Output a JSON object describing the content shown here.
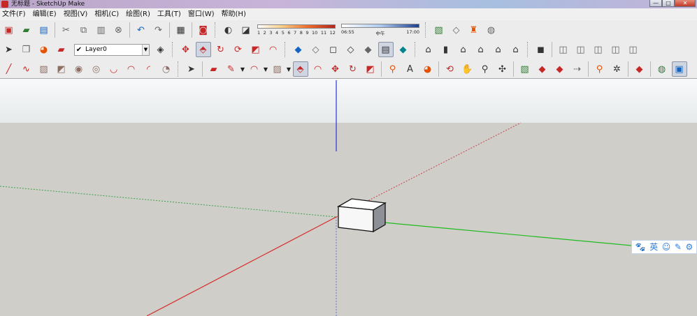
{
  "window": {
    "title": "无标题 - SketchUp Make",
    "controls": [
      "—",
      "□",
      "✕"
    ]
  },
  "menu": [
    "文件(F)",
    "编辑(E)",
    "视图(V)",
    "相机(C)",
    "绘图(R)",
    "工具(T)",
    "窗口(W)",
    "帮助(H)"
  ],
  "layer": {
    "check": "✔",
    "name": "Layer0",
    "arrow": "▼"
  },
  "shadow": {
    "months": [
      "1",
      "2",
      "3",
      "4",
      "5",
      "6",
      "7",
      "8",
      "9",
      "10",
      "11",
      "12"
    ],
    "time_start": "06:55",
    "time_mid": "中午",
    "time_end": "17:00"
  },
  "ime": {
    "paw": "🐾",
    "lang": "英",
    "smile": "☺",
    "pen": "✎",
    "gear": "⚙"
  },
  "dropdown_glyph": "▼",
  "icons": {
    "row1": [
      {
        "name": "new-model-icon",
        "g": "▣",
        "c": "c-red"
      },
      {
        "name": "open-folder-icon",
        "g": "▰",
        "c": "c-green"
      },
      {
        "name": "save-icon",
        "g": "▤",
        "c": "c-blue"
      },
      {
        "sep": true
      },
      {
        "name": "cut-icon",
        "g": "✂",
        "c": "c-gray"
      },
      {
        "name": "copy-icon",
        "g": "⧉",
        "c": "c-gray"
      },
      {
        "name": "paste-icon",
        "g": "▥",
        "c": "c-gray"
      },
      {
        "name": "erase-icon",
        "g": "⊗",
        "c": "c-gray"
      },
      {
        "sep": true
      },
      {
        "name": "undo-icon",
        "g": "↶",
        "c": "c-blue"
      },
      {
        "name": "redo-icon",
        "g": "↷",
        "c": "c-gray"
      },
      {
        "sep": true
      },
      {
        "name": "print-icon",
        "g": "▦",
        "c": "c-dark"
      },
      {
        "sep": true
      },
      {
        "name": "model-info-icon",
        "g": "◙",
        "c": "c-red"
      },
      {
        "grip": true
      },
      {
        "name": "shadow-settings-icon",
        "g": "◐",
        "c": "c-dark"
      },
      {
        "name": "display-shadows-icon",
        "g": "◪",
        "c": "c-dark"
      },
      {
        "slider": "warm"
      },
      {
        "slider": "cool"
      },
      {
        "grip": true
      },
      {
        "name": "add-location-icon",
        "g": "▧",
        "c": "c-green"
      },
      {
        "name": "toggle-terrain-icon",
        "g": "◇",
        "c": "c-gray"
      },
      {
        "name": "photo-textures-icon",
        "g": "♜",
        "c": "c-orange"
      },
      {
        "name": "preview-google-earth-icon",
        "g": "◍",
        "c": "c-gray"
      }
    ],
    "row2": [
      {
        "name": "select-icon",
        "g": "➤",
        "c": "c-dark"
      },
      {
        "name": "make-component-icon",
        "g": "❒",
        "c": "c-gray"
      },
      {
        "name": "paint-bucket-icon",
        "g": "◕",
        "c": "c-orange"
      },
      {
        "name": "eraser-icon",
        "g": "▰",
        "c": "c-red"
      },
      {
        "layer": true
      },
      {
        "name": "layer-manager-icon",
        "g": "◈",
        "c": "c-dark"
      },
      {
        "grip": true
      },
      {
        "name": "move-icon",
        "g": "✥",
        "c": "c-red"
      },
      {
        "name": "push-pull-icon",
        "g": "⬘",
        "c": "c-red",
        "pressed": true
      },
      {
        "name": "rotate-icon",
        "g": "↻",
        "c": "c-red"
      },
      {
        "name": "follow-me-icon",
        "g": "⟳",
        "c": "c-red"
      },
      {
        "name": "scale-icon",
        "g": "◩",
        "c": "c-red"
      },
      {
        "name": "offset-icon",
        "g": "◠",
        "c": "c-red"
      },
      {
        "grip": true
      },
      {
        "name": "xray-style-icon",
        "g": "◆",
        "c": "c-blue"
      },
      {
        "name": "back-edges-style-icon",
        "g": "◇",
        "c": "c-gray"
      },
      {
        "name": "wireframe-style-icon",
        "g": "◻",
        "c": "c-dark"
      },
      {
        "name": "hidden-line-style-icon",
        "g": "◇",
        "c": "c-dark"
      },
      {
        "name": "shaded-style-icon",
        "g": "◆",
        "c": "c-gray"
      },
      {
        "name": "shaded-textures-style-icon",
        "g": "▤",
        "c": "c-dark",
        "pressed": true
      },
      {
        "name": "monochrome-style-icon",
        "g": "◆",
        "c": "c-teal"
      },
      {
        "grip": true
      },
      {
        "name": "iso-view-icon",
        "g": "⌂",
        "c": "c-dark"
      },
      {
        "name": "top-view-icon",
        "g": "▮",
        "c": "c-dark"
      },
      {
        "name": "front-view-icon",
        "g": "⌂",
        "c": "c-dark"
      },
      {
        "name": "right-view-icon",
        "g": "⌂",
        "c": "c-dark"
      },
      {
        "name": "back-view-icon",
        "g": "⌂",
        "c": "c-dark"
      },
      {
        "name": "left-view-icon",
        "g": "⌂",
        "c": "c-dark"
      },
      {
        "grip": true
      },
      {
        "name": "outer-shell-icon",
        "g": "◼",
        "c": "c-dark"
      },
      {
        "sep": true
      },
      {
        "name": "union-icon",
        "g": "◫",
        "c": "c-gray"
      },
      {
        "name": "subtract-icon",
        "g": "◫",
        "c": "c-gray"
      },
      {
        "name": "intersect-icon",
        "g": "◫",
        "c": "c-gray"
      },
      {
        "name": "trim-icon",
        "g": "◫",
        "c": "c-gray"
      },
      {
        "name": "split-icon",
        "g": "◫",
        "c": "c-gray"
      }
    ],
    "row3": [
      {
        "name": "line-tool-icon",
        "g": "╱",
        "c": "c-red"
      },
      {
        "name": "freehand-tool-icon",
        "g": "∿",
        "c": "c-red"
      },
      {
        "name": "rectangle-tool-icon",
        "g": "▨",
        "c": "c-brown"
      },
      {
        "name": "rotated-rectangle-icon",
        "g": "◩",
        "c": "c-brown"
      },
      {
        "name": "circle-tool-icon",
        "g": "◉",
        "c": "c-brown"
      },
      {
        "name": "polygon-tool-icon",
        "g": "◎",
        "c": "c-brown"
      },
      {
        "name": "arc-tool-icon",
        "g": "◡",
        "c": "c-red"
      },
      {
        "name": "two-point-arc-icon",
        "g": "◠",
        "c": "c-red"
      },
      {
        "name": "three-point-arc-icon",
        "g": "◜",
        "c": "c-red"
      },
      {
        "name": "pie-tool-icon",
        "g": "◔",
        "c": "c-brown"
      },
      {
        "grip": true
      },
      {
        "name": "select-tool-icon",
        "g": "➤",
        "c": "c-dark"
      },
      {
        "sep": true
      },
      {
        "name": "eraser-tool-icon",
        "g": "▰",
        "c": "c-red"
      },
      {
        "name": "pencil-tool-icon",
        "g": "✎",
        "c": "c-red"
      },
      {
        "dd": true
      },
      {
        "name": "arc-dropdown-icon",
        "g": "◠",
        "c": "c-red"
      },
      {
        "dd": true
      },
      {
        "name": "shapes-dropdown-icon",
        "g": "▨",
        "c": "c-brown"
      },
      {
        "dd": true
      },
      {
        "name": "push-pull-tool-icon",
        "g": "⬘",
        "c": "c-red",
        "pressed": true
      },
      {
        "name": "offset-tool-icon",
        "g": "◠",
        "c": "c-red"
      },
      {
        "name": "move-tool-icon",
        "g": "✥",
        "c": "c-red"
      },
      {
        "name": "rotate-tool-icon",
        "g": "↻",
        "c": "c-red"
      },
      {
        "name": "scale-tool-icon",
        "g": "◩",
        "c": "c-red"
      },
      {
        "sep": true
      },
      {
        "name": "tape-measure-icon",
        "g": "⚲",
        "c": "c-orange"
      },
      {
        "name": "text-tool-icon",
        "g": "A",
        "c": "c-dark"
      },
      {
        "name": "paint-tool-icon",
        "g": "◕",
        "c": "c-orange"
      },
      {
        "sep": true
      },
      {
        "name": "orbit-icon",
        "g": "⟲",
        "c": "c-red"
      },
      {
        "name": "pan-icon",
        "g": "✋",
        "c": "c-dark"
      },
      {
        "name": "zoom-icon",
        "g": "⚲",
        "c": "c-dark"
      },
      {
        "name": "zoom-extents-icon",
        "g": "✣",
        "c": "c-dark"
      },
      {
        "sep": true
      },
      {
        "name": "warehouse-icon",
        "g": "▧",
        "c": "c-green"
      },
      {
        "name": "share-model-icon",
        "g": "◆",
        "c": "c-red"
      },
      {
        "name": "components-icon",
        "g": "◆",
        "c": "c-red"
      },
      {
        "name": "extension-warehouse-icon",
        "g": "⇢",
        "c": "c-gray"
      },
      {
        "sep": true
      },
      {
        "name": "dimension-tool-icon",
        "g": "⚲",
        "c": "c-orange"
      },
      {
        "name": "axes-tool-icon",
        "g": "✲",
        "c": "c-dark"
      },
      {
        "sep": true
      },
      {
        "name": "section-plane-icon",
        "g": "◆",
        "c": "c-red"
      },
      {
        "sep": true
      },
      {
        "name": "walk-icon",
        "g": "◍",
        "c": "c-green"
      },
      {
        "name": "position-camera-icon",
        "g": "▣",
        "c": "c-blue",
        "pressed": true
      }
    ]
  }
}
